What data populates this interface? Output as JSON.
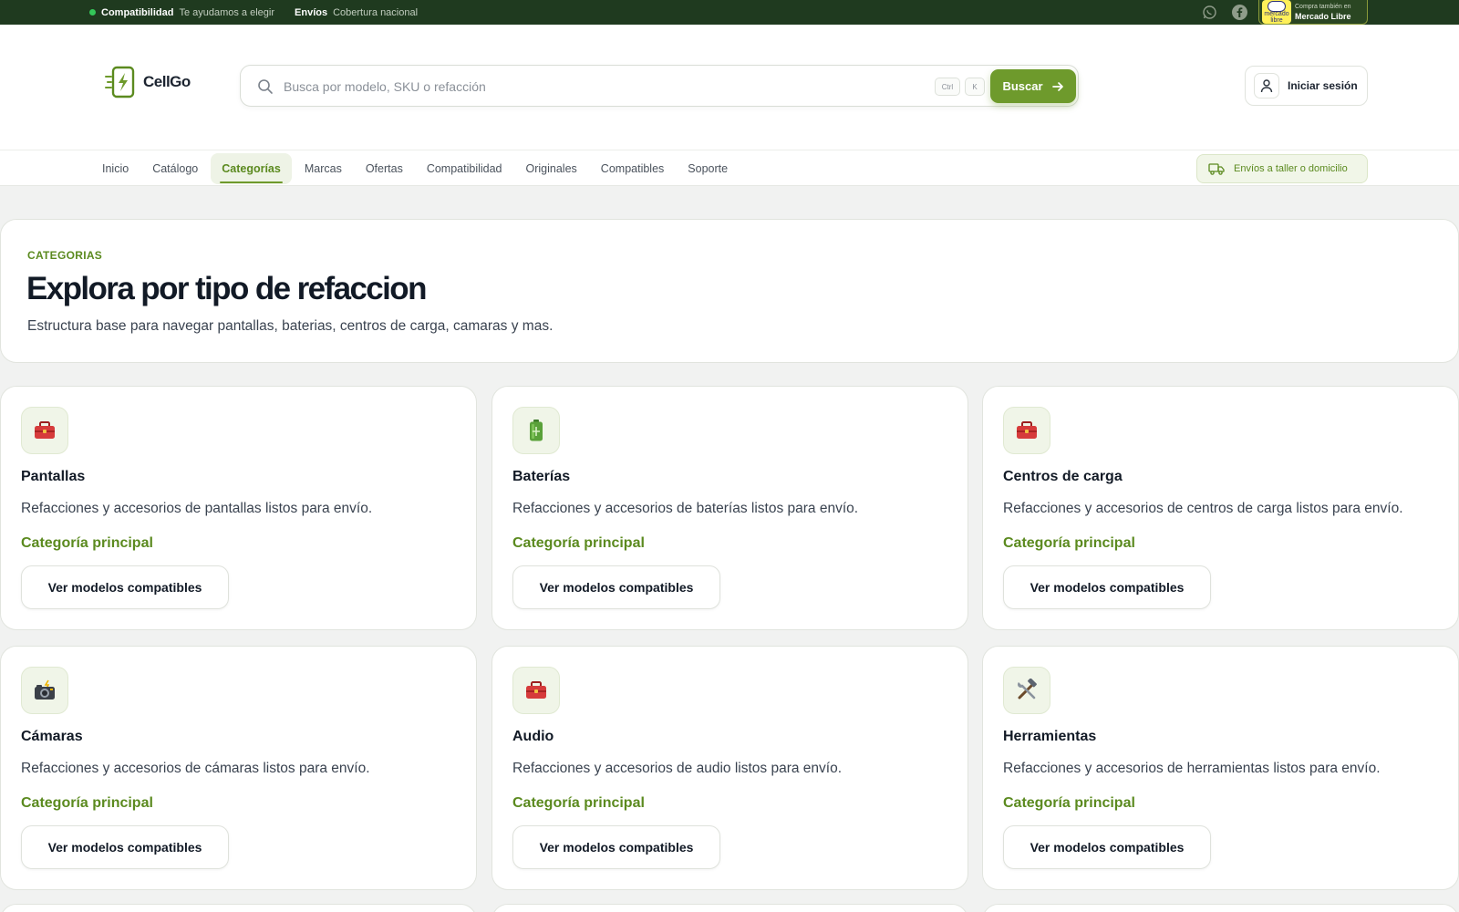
{
  "topbar": {
    "compat_label": "Compatibilidad",
    "compat_text": "Te ayudamos a elegir",
    "ship_label": "Envíos",
    "ship_text": "Cobertura nacional",
    "ml_small": "Compra también en",
    "ml_big": "Mercado Libre",
    "ml_logo_text": "mercado libre"
  },
  "header": {
    "logo_text": "CellGo",
    "search_placeholder": "Busca por modelo, SKU o refacción",
    "kbd_ctrl": "Ctrl",
    "kbd_k": "K",
    "search_button": "Buscar",
    "login_label": "Iniciar sesión"
  },
  "nav": {
    "items": [
      "Inicio",
      "Catálogo",
      "Categorías",
      "Marcas",
      "Ofertas",
      "Compatibilidad",
      "Originales",
      "Compatibles",
      "Soporte"
    ],
    "active": "Categorías",
    "ship_pill": "Envíos a taller o domicilio"
  },
  "hero": {
    "eyebrow": "CATEGORIAS",
    "title": "Explora por tipo de refaccion",
    "subtitle": "Estructura base para navegar pantallas, baterias, centros de carga, camaras y mas."
  },
  "categories": [
    {
      "title": "Pantallas",
      "icon": "toolbox-icon",
      "desc": "Refacciones y accesorios de pantallas listos para envío.",
      "tag": "Categoría principal",
      "button": "Ver modelos compatibles"
    },
    {
      "title": "Baterías",
      "icon": "battery-icon",
      "desc": "Refacciones y accesorios de baterías listos para envío.",
      "tag": "Categoría principal",
      "button": "Ver modelos compatibles"
    },
    {
      "title": "Centros de carga",
      "icon": "toolbox-icon",
      "desc": "Refacciones y accesorios de centros de carga listos para envío.",
      "tag": "Categoría principal",
      "button": "Ver modelos compatibles"
    },
    {
      "title": "Cámaras",
      "icon": "camera-flash-icon",
      "desc": "Refacciones y accesorios de cámaras listos para envío.",
      "tag": "Categoría principal",
      "button": "Ver modelos compatibles"
    },
    {
      "title": "Audio",
      "icon": "toolbox-icon",
      "desc": "Refacciones y accesorios de audio listos para envío.",
      "tag": "Categoría principal",
      "button": "Ver modelos compatibles"
    },
    {
      "title": "Herramientas",
      "icon": "hammer-wrench-icon",
      "desc": "Refacciones y accesorios de herramientas listos para envío.",
      "tag": "Categoría principal",
      "button": "Ver modelos compatibles"
    }
  ],
  "colors": {
    "brand_green": "#6e9a2c",
    "accent_text_green": "#5b8a1f",
    "topbar_bg": "#1f3a1f",
    "status_dot": "#34c759"
  }
}
